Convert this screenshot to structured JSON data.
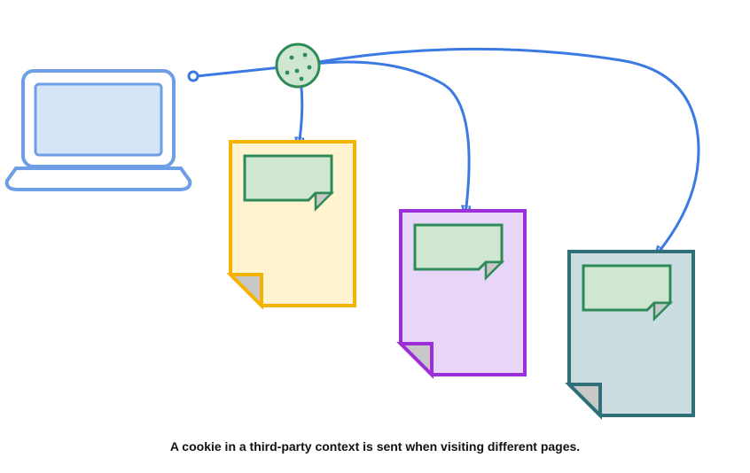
{
  "caption": "A cookie in a third-party context is sent when visiting different pages.",
  "colors": {
    "laptop_stroke": "#6d9ee6",
    "laptop_screen_fill": "#d6e4f7",
    "arrow_stroke": "#3b7ae2",
    "cookie_stroke": "#2e8b57",
    "cookie_fill": "#cfe7d1",
    "page_yellow_stroke": "#f5b301",
    "page_yellow_fill": "#fff4cf",
    "page_purple_stroke": "#9d2fd9",
    "page_purple_fill": "#e7d6f7",
    "page_teal_stroke": "#2f6f77",
    "page_teal_fill": "#cbdde1",
    "inset_stroke": "#2e8b57",
    "inset_fill": "#cfe7d1",
    "fold_fill": "#c8c8c8"
  }
}
